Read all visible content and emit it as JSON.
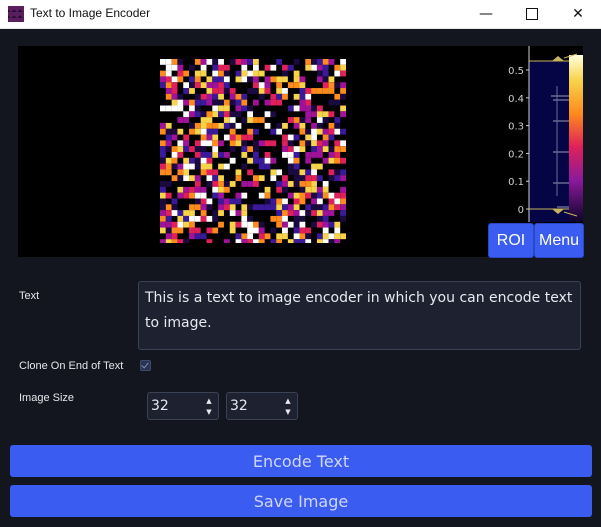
{
  "window": {
    "title": "Text to Image Encoder",
    "minimize_glyph": "—",
    "close_glyph": "✕"
  },
  "histogram": {
    "ticks": [
      "0.5",
      "0.4",
      "0.3",
      "0.2",
      "0.1",
      "0"
    ]
  },
  "lut_buttons": {
    "roi": "ROI",
    "menu": "Menu"
  },
  "form": {
    "text_label": "Text",
    "text_value": "This is a text to image encoder in which you can encode text to image.",
    "clone_label": "Clone On End of Text",
    "clone_checked": true,
    "size_label": "Image Size",
    "width": "32",
    "height": "32",
    "up_glyph": "▲",
    "down_glyph": "▼"
  },
  "actions": {
    "encode": "Encode Text",
    "save": "Save Image"
  },
  "colors": {
    "accent": "#3b5cf0",
    "background": "#14161f",
    "palette": [
      "#ffffff",
      "#f7d44a",
      "#ff8a1e",
      "#e0205a",
      "#a0129a",
      "#3a1a9a",
      "#1a0a40"
    ]
  }
}
